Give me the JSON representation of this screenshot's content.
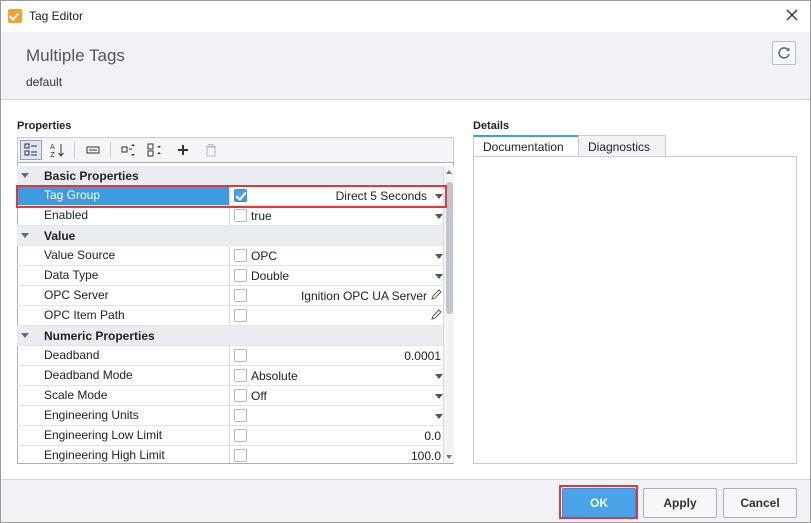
{
  "window": {
    "title": "Tag Editor"
  },
  "header": {
    "title": "Multiple Tags",
    "subtitle": "default"
  },
  "properties_panel": {
    "label": "Properties",
    "groups": [
      {
        "name": "Basic Properties",
        "rows": [
          {
            "name": "Tag Group",
            "checked": true,
            "value": "Direct 5 Seconds",
            "align": "right",
            "control": "dropdown",
            "selected": true
          },
          {
            "name": "Enabled",
            "checked": false,
            "value": "true",
            "align": "left",
            "control": "dropdown"
          }
        ]
      },
      {
        "name": "Value",
        "rows": [
          {
            "name": "Value Source",
            "checked": false,
            "value": "OPC",
            "align": "left",
            "control": "dropdown"
          },
          {
            "name": "Data Type",
            "checked": false,
            "value": "Double",
            "align": "left",
            "control": "dropdown"
          },
          {
            "name": "OPC Server",
            "checked": false,
            "value": "Ignition OPC UA Server",
            "align": "right",
            "control": "edit"
          },
          {
            "name": "OPC Item Path",
            "checked": false,
            "value": "",
            "align": "right",
            "control": "edit"
          }
        ]
      },
      {
        "name": "Numeric Properties",
        "rows": [
          {
            "name": "Deadband",
            "checked": false,
            "value": "0.0001",
            "align": "right-num",
            "control": "none"
          },
          {
            "name": "Deadband Mode",
            "checked": false,
            "value": "Absolute",
            "align": "left",
            "control": "dropdown"
          },
          {
            "name": "Scale Mode",
            "checked": false,
            "value": "Off",
            "align": "left",
            "control": "dropdown"
          },
          {
            "name": "Engineering Units",
            "checked": false,
            "value": "",
            "align": "left",
            "control": "dropdown"
          },
          {
            "name": "Engineering Low Limit",
            "checked": false,
            "value": "0.0",
            "align": "right-num",
            "control": "none"
          },
          {
            "name": "Engineering High Limit",
            "checked": false,
            "value": "100.0",
            "align": "right-num",
            "control": "none"
          }
        ]
      }
    ]
  },
  "details_panel": {
    "label": "Details",
    "tabs": [
      {
        "label": "Documentation",
        "active": true
      },
      {
        "label": "Diagnostics",
        "active": false
      }
    ]
  },
  "footer": {
    "ok_label": "OK",
    "apply_label": "Apply",
    "cancel_label": "Cancel"
  },
  "colors": {
    "accent": "#3d9be0",
    "highlight": "#e0383e",
    "primary_button": "#4aa3e6"
  }
}
